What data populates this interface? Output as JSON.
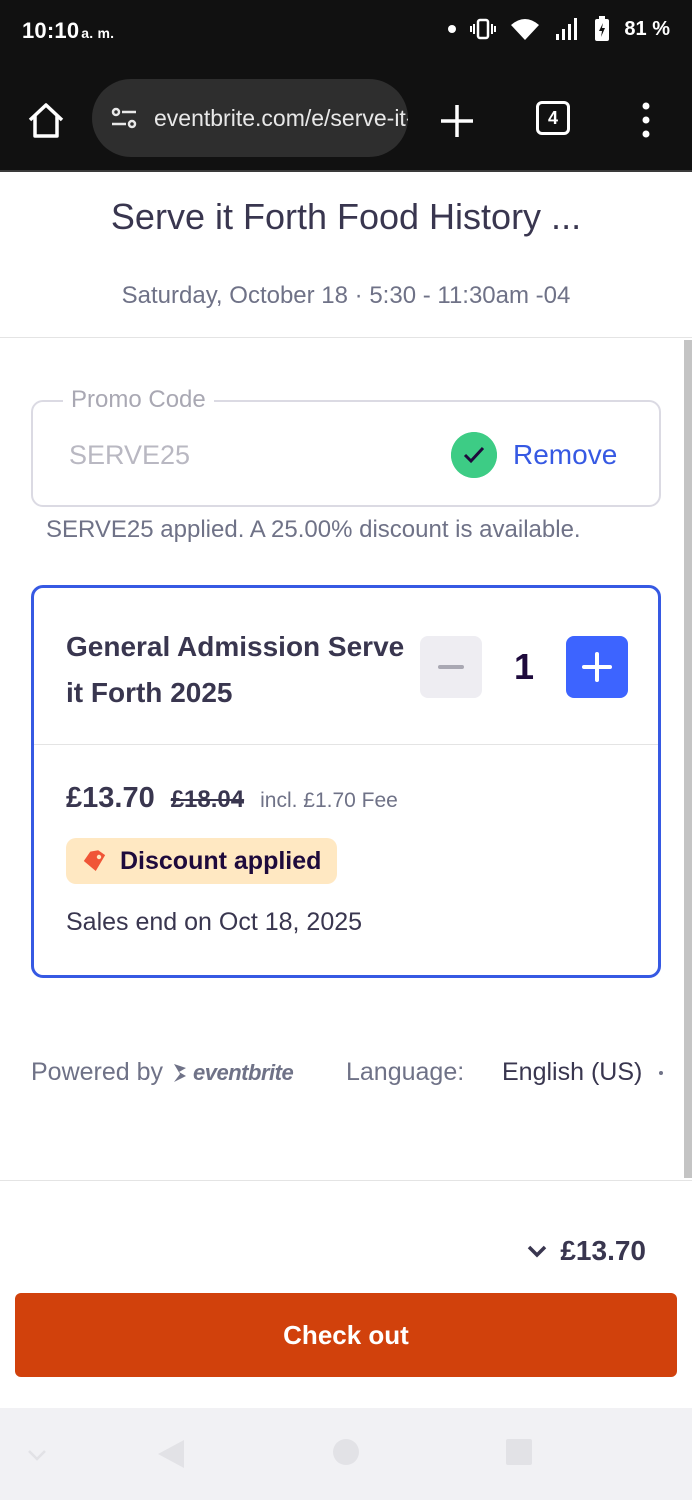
{
  "status_bar": {
    "time": "10:10",
    "ampm": "a. m.",
    "battery": "81 %"
  },
  "browser": {
    "url": "eventbrite.com/e/serve-it-forth",
    "tab_count": "4"
  },
  "event": {
    "title": "Serve it Forth Food History ...",
    "date": "Saturday, October 18 · 5:30 - 11:30am -04"
  },
  "promo": {
    "label": "Promo Code",
    "code": "SERVE25",
    "remove_label": "Remove",
    "message": "SERVE25 applied. A 25.00% discount is available."
  },
  "ticket": {
    "name": "General Admission Serve it Forth 2025",
    "quantity": "1",
    "price": "£13.70",
    "original_price": "£18.04",
    "fee": "incl. £1.70 Fee",
    "discount_label": "Discount applied",
    "sales_end": "Sales end on Oct 18, 2025"
  },
  "footer": {
    "powered_by": "Powered by",
    "brand": "eventbrite",
    "language_label": "Language:",
    "language_value": "English (US)"
  },
  "checkout": {
    "total": "£13.70",
    "button_label": "Check out"
  },
  "colors": {
    "accent_blue": "#3659e3",
    "checkout_orange": "#d1410c",
    "discount_bg": "#ffe8c2",
    "success_green": "#3dcc85"
  }
}
